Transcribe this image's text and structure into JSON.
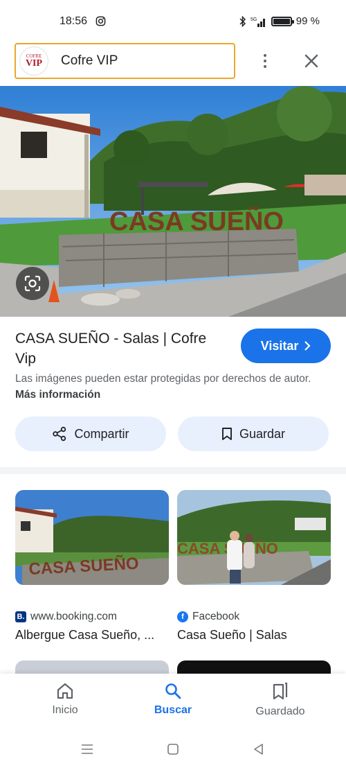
{
  "status_bar": {
    "time": "18:56",
    "battery": "99 %",
    "battery_level": 0.99,
    "icons": [
      "instagram-icon",
      "bluetooth-icon",
      "signal-icon",
      "battery-icon"
    ]
  },
  "header": {
    "site_logo_line1": "COFRE",
    "site_logo_line2": "VIP",
    "search_text": "Cofre VIP",
    "more_icon": "more-vert-icon",
    "close_icon": "close-icon"
  },
  "hero": {
    "sign_text": "CASA SUEÑO",
    "lens_icon": "google-lens-icon"
  },
  "result": {
    "title": "CASA SUEÑO - Salas | Cofre Vip",
    "visit_label": "Visitar",
    "copyright_text": "Las imágenes pueden estar protegidas por derechos de autor.",
    "more_info_label": "Más información",
    "share_label": "Compartir",
    "save_label": "Guardar"
  },
  "related": [
    {
      "source": "www.booking.com",
      "caption": "Albergue Casa Sueño, ...",
      "favicon": "B.",
      "thumb_sign": "CASA SUEÑO"
    },
    {
      "source": "Facebook",
      "caption": "Casa Sueño | Salas",
      "favicon": "f",
      "thumb_sign": "CASA SUEÑO"
    }
  ],
  "bottom_nav": {
    "items": [
      {
        "label": "Inicio",
        "icon": "home-icon",
        "active": false
      },
      {
        "label": "Buscar",
        "icon": "search-icon",
        "active": true
      },
      {
        "label": "Guardado",
        "icon": "bookmarks-icon",
        "active": false
      }
    ]
  },
  "colors": {
    "accent": "#1a73e8",
    "chip_bg": "#e8f0fe",
    "search_border": "#e8a82a"
  }
}
